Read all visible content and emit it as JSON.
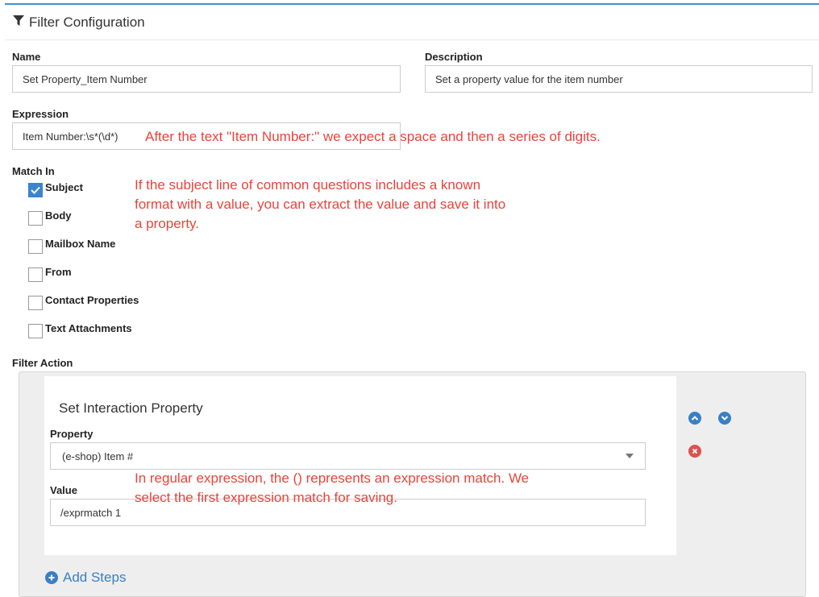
{
  "header": {
    "title": "Filter Configuration",
    "icon": "filter-icon"
  },
  "name": {
    "label": "Name",
    "value": "Set Property_Item Number"
  },
  "description": {
    "label": "Description",
    "value": "Set a property value for the item number"
  },
  "expression": {
    "label": "Expression",
    "value": "Item Number:\\s*(\\d*)"
  },
  "match_in": {
    "label": "Match In",
    "options": [
      {
        "label": "Subject",
        "checked": true
      },
      {
        "label": "Body",
        "checked": false
      },
      {
        "label": "Mailbox Name",
        "checked": false
      },
      {
        "label": "From",
        "checked": false
      },
      {
        "label": "Contact Properties",
        "checked": false
      },
      {
        "label": "Text Attachments",
        "checked": false
      }
    ]
  },
  "annotations": {
    "expression_note": "After the text \"Item Number:\" we expect a space and then a series of digits.",
    "match_note": "If the subject line of common questions includes a known format with a value, you can extract the value and save it into a property.",
    "value_note": "In regular expression, the () represents an expression match. We select the first expression match for saving."
  },
  "filter_action": {
    "label": "Filter Action",
    "step_title": "Set Interaction Property",
    "property_label": "Property",
    "property_value": "(e-shop) Item #",
    "value_label": "Value",
    "value_value": "/exprmatch 1",
    "add_steps": "Add Steps"
  },
  "colors": {
    "accent": "#3a84d0",
    "annotation": "#e8443a",
    "remove": "#d9534f"
  }
}
